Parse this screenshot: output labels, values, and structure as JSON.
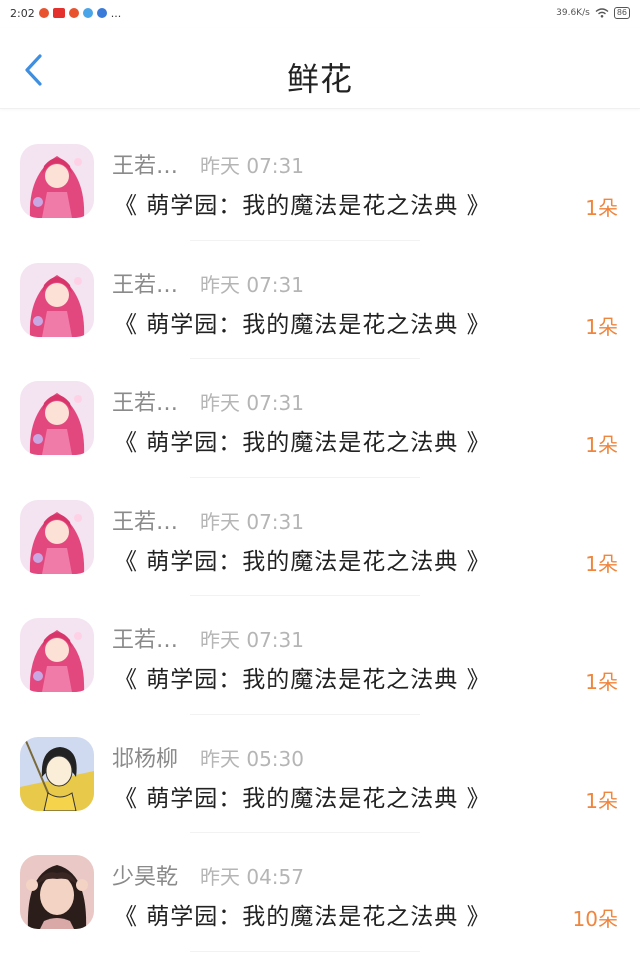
{
  "status_bar": {
    "time": "2:02",
    "ellipsis": "...",
    "net_speed": "39.6K/s",
    "battery": "86",
    "app_colors": [
      "#e8532e",
      "#e4312e",
      "#e8532e",
      "#4aa4e8",
      "#3a7ad8"
    ]
  },
  "header": {
    "title": "鲜花",
    "back_icon": "chevron-left-icon",
    "accent_color": "#3f8fe0"
  },
  "gifts": [
    {
      "name": "王若…",
      "time": "昨天 07:31",
      "book": "《 萌学园：我的魔法是花之法典 》",
      "count": "1朵",
      "avatar": "anime-girl"
    },
    {
      "name": "王若…",
      "time": "昨天 07:31",
      "book": "《 萌学园：我的魔法是花之法典 》",
      "count": "1朵",
      "avatar": "anime-girl"
    },
    {
      "name": "王若…",
      "time": "昨天 07:31",
      "book": "《 萌学园：我的魔法是花之法典 》",
      "count": "1朵",
      "avatar": "anime-girl"
    },
    {
      "name": "王若…",
      "time": "昨天 07:31",
      "book": "《 萌学园：我的魔法是花之法典 》",
      "count": "1朵",
      "avatar": "anime-girl"
    },
    {
      "name": "王若…",
      "time": "昨天 07:31",
      "book": "《 萌学园：我的魔法是花之法典 》",
      "count": "1朵",
      "avatar": "anime-girl"
    },
    {
      "name": "邶杨柳",
      "time": "昨天 05:30",
      "book": "《 萌学园：我的魔法是花之法典 》",
      "count": "1朵",
      "avatar": "comic-girl"
    },
    {
      "name": "少昊乾",
      "time": "昨天 04:57",
      "book": "《 萌学园：我的魔法是花之法典 》",
      "count": "10朵",
      "avatar": "photo-person"
    }
  ]
}
